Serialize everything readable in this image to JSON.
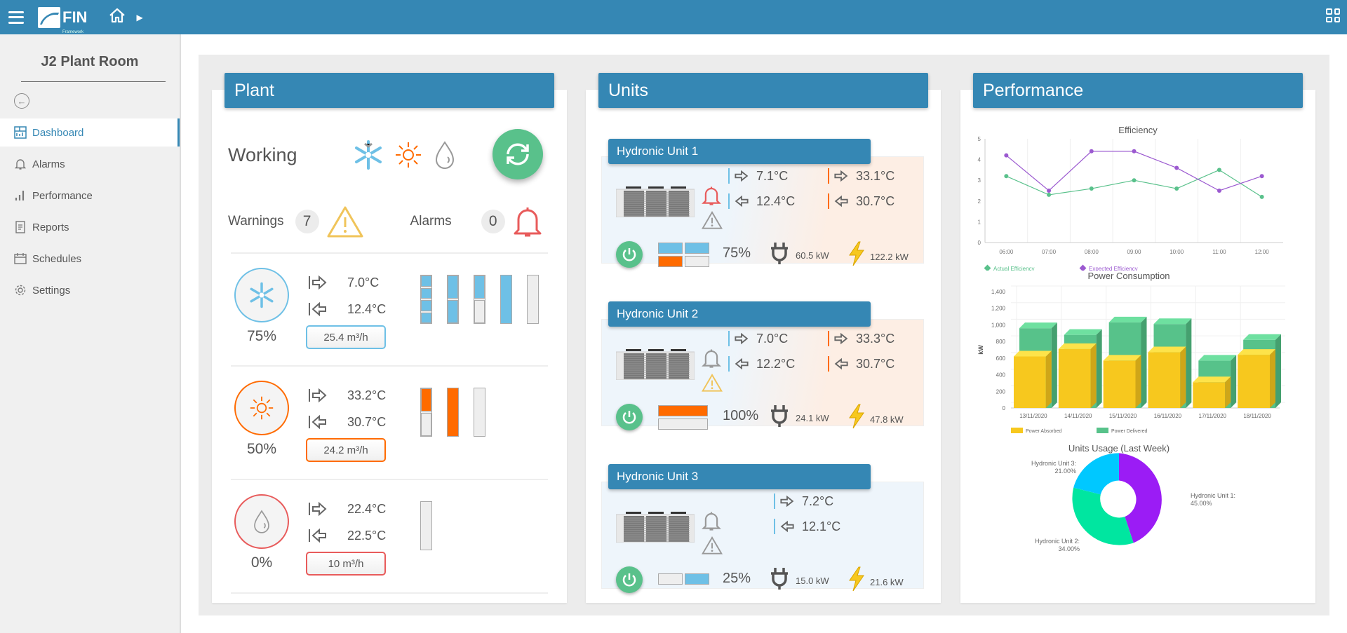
{
  "header": {
    "logo_text": "FIN",
    "logo_sub": "Framework",
    "icons": [
      "menu-icon",
      "home-icon",
      "chevron-right-icon",
      "grid-icon"
    ]
  },
  "sidebar": {
    "title": "J2 Plant Room",
    "items": [
      {
        "label": "Dashboard",
        "icon": "dashboard-icon",
        "active": true
      },
      {
        "label": "Alarms",
        "icon": "bell-icon"
      },
      {
        "label": "Performance",
        "icon": "bar-chart-icon"
      },
      {
        "label": "Reports",
        "icon": "document-icon"
      },
      {
        "label": "Schedules",
        "icon": "calendar-icon"
      },
      {
        "label": "Settings",
        "icon": "gear-icon"
      }
    ]
  },
  "plant": {
    "title": "Plant",
    "status": "Working",
    "warnings_label": "Warnings",
    "warnings_count": "7",
    "alarms_label": "Alarms",
    "alarms_count": "0",
    "circuits": [
      {
        "type": "cooling",
        "percent": "75%",
        "supply": "7.0°C",
        "return": "12.4°C",
        "flow": "25.4 m³/h",
        "bars": [
          [
            1,
            1,
            1,
            1
          ],
          [
            1,
            1
          ],
          [
            1,
            0
          ],
          [
            1
          ],
          [
            0
          ]
        ]
      },
      {
        "type": "heating",
        "percent": "50%",
        "supply": "33.2°C",
        "return": "30.7°C",
        "flow": "24.2 m³/h",
        "bars": [
          [
            1,
            0
          ],
          [
            1
          ],
          [
            0
          ]
        ]
      },
      {
        "type": "dhw",
        "percent": "0%",
        "supply": "22.4°C",
        "return": "22.5°C",
        "flow": "10 m³/h",
        "bars": [
          [
            0
          ]
        ]
      }
    ]
  },
  "units": {
    "title": "Units",
    "list": [
      {
        "name": "Hydronic Unit 1",
        "alarm_active": true,
        "warning_active": false,
        "cold_supply": "7.1°C",
        "cold_return": "12.4°C",
        "hot_supply": "33.1°C",
        "hot_return": "30.7°C",
        "load": "75%",
        "power_absorbed": "60.5 kW",
        "power_delivered": "122.2 kW"
      },
      {
        "name": "Hydronic Unit 2",
        "alarm_active": false,
        "warning_active": true,
        "cold_supply": "7.0°C",
        "cold_return": "12.2°C",
        "hot_supply": "33.3°C",
        "hot_return": "30.7°C",
        "load": "100%",
        "power_absorbed": "24.1 kW",
        "power_delivered": "47.8 kW"
      },
      {
        "name": "Hydronic Unit 3",
        "alarm_active": false,
        "warning_active": false,
        "cold_supply": "7.2°C",
        "cold_return": "12.1°C",
        "load": "25%",
        "power_absorbed": "15.0 kW",
        "power_delivered": "21.6 kW"
      }
    ]
  },
  "performance": {
    "title": "Performance"
  },
  "colors": {
    "accent": "#3587b4",
    "green": "#59c18b",
    "cold": "#6ec0e6",
    "hot": "#ff6b00",
    "alarm": "#e85b5b",
    "warning": "#f0c45a"
  },
  "chart_data": [
    {
      "type": "line",
      "title": "Efficiency",
      "x": [
        "06:00",
        "07:00",
        "08:00",
        "09:00",
        "10:00",
        "11:00",
        "12:00"
      ],
      "ylim": [
        0,
        5
      ],
      "yticks": [
        0,
        1,
        2,
        3,
        4,
        5
      ],
      "grid": true,
      "legend": "bottom-left",
      "series": [
        {
          "name": "Actual Efficiency",
          "color": "#59c18b",
          "values": [
            3.2,
            2.3,
            2.6,
            3.0,
            2.6,
            3.5,
            2.2
          ]
        },
        {
          "name": "Expected Efficiency",
          "color": "#9b59d0",
          "values": [
            4.2,
            2.5,
            4.4,
            4.4,
            3.6,
            2.5,
            3.2
          ]
        }
      ]
    },
    {
      "type": "bar",
      "title": "Power Consumption",
      "ylabel": "kW",
      "categories": [
        "13/11/2020",
        "14/11/2020",
        "15/11/2020",
        "16/11/2020",
        "17/11/2020",
        "18/11/2020"
      ],
      "ylim": [
        0,
        1400
      ],
      "yticks": [
        0,
        200,
        400,
        600,
        800,
        1000,
        1200,
        1400
      ],
      "ytick_labels": [
        "0",
        "200",
        "400",
        "600",
        "800",
        "1,000",
        "1,200",
        "1,400"
      ],
      "legend": "bottom-left",
      "series": [
        {
          "name": "Power Absorbed",
          "color": "#f7c81e",
          "values": [
            620,
            710,
            570,
            670,
            310,
            640
          ]
        },
        {
          "name": "Power Delivered",
          "color": "#57c28a",
          "values": [
            960,
            880,
            1030,
            1010,
            570,
            820
          ]
        }
      ]
    },
    {
      "type": "pie",
      "title": "Units Usage (Last Week)",
      "slices": [
        {
          "label": "Hydronic Unit 1",
          "value": 45,
          "display": "45.00%",
          "color": "#9b1cf5"
        },
        {
          "label": "Hydronic Unit 2",
          "value": 34,
          "display": "34.00%",
          "color": "#00e6a0"
        },
        {
          "label": "Hydronic Unit 3",
          "value": 21,
          "display": "21.00%",
          "color": "#00c8ff"
        }
      ]
    }
  ]
}
